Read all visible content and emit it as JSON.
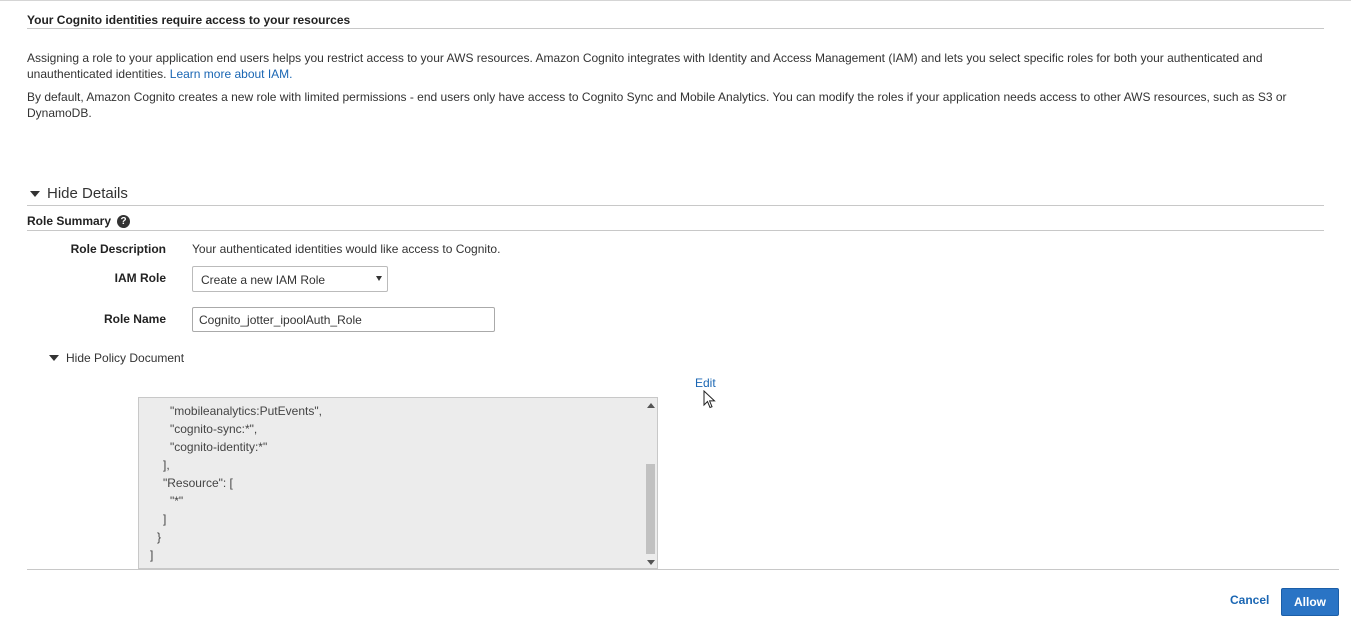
{
  "section": {
    "title": "Your Cognito identities require access to your resources",
    "para1_text": "Assigning a role to your application end users helps you restrict access to your AWS resources. Amazon Cognito integrates with Identity and Access Management (IAM) and lets you select specific roles for both your authenticated and unauthenticated identities.",
    "para1_link": "Learn more about IAM.",
    "para2_text": "By default, Amazon Cognito creates a new role with limited permissions - end users only have access to Cognito Sync and Mobile Analytics. You can modify the roles if your application needs access to other AWS resources, such as S3 or DynamoDB."
  },
  "details": {
    "toggle_label": "Hide Details",
    "role_summary_label": "Role Summary",
    "help_glyph": "?",
    "role_description_label": "Role Description",
    "role_description_value": "Your authenticated identities would like access to Cognito.",
    "iam_role_label": "IAM Role",
    "iam_role_selected": "Create a new IAM Role",
    "role_name_label": "Role Name",
    "role_name_value": "Cognito_jotter_ipoolAuth_Role",
    "policy_toggle_label": "Hide Policy Document",
    "edit_label": "Edit",
    "policy_lines": [
      "\"mobileanalytics:PutEvents\",",
      "\"cognito-sync:*\",",
      "\"cognito-identity:*\"",
      "],",
      "\"Resource\": [",
      "\"*\"",
      "]",
      "}",
      "]"
    ]
  },
  "footer": {
    "cancel_label": "Cancel",
    "allow_label": "Allow"
  },
  "colors": {
    "link": "#1a66b3",
    "primary_button": "#2a74c5",
    "policy_background": "#ececec"
  },
  "icons": {
    "help": "help-circle-icon",
    "collapse": "caret-down-icon",
    "cursor": "mouse-pointer-icon"
  }
}
